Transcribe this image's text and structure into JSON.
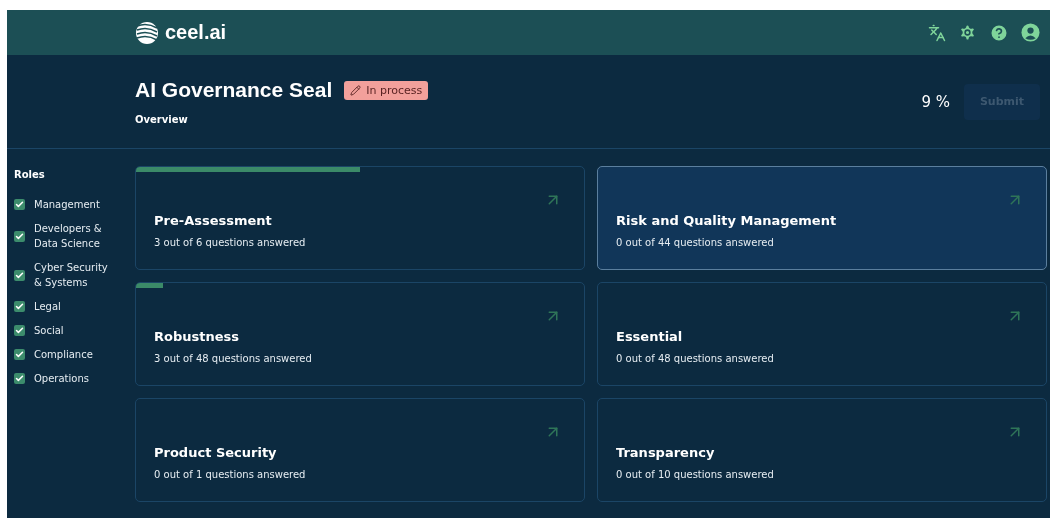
{
  "header": {
    "logo": "ceel.ai"
  },
  "page": {
    "title": "AI Governance Seal",
    "status": "In process",
    "subtitle": "Overview",
    "progress": "9 %",
    "submit": {
      "label": "Submit",
      "disabled": true
    }
  },
  "sidebar": {
    "heading": "Roles",
    "items": [
      {
        "label": "Management",
        "checked": true
      },
      {
        "label": "Developers & Data Science",
        "checked": true
      },
      {
        "label": "Cyber Security & Systems",
        "checked": true
      },
      {
        "label": "Legal",
        "checked": true
      },
      {
        "label": "Social",
        "checked": true
      },
      {
        "label": "Compliance",
        "checked": true
      },
      {
        "label": "Operations",
        "checked": true
      }
    ]
  },
  "cards": [
    {
      "title": "Pre-Assessment",
      "answered": "3 out of 6 questions answered",
      "level": 0.5,
      "selected": false
    },
    {
      "title": "Risk and Quality Management",
      "answered": "0 out of 44 questions answered",
      "selected": true
    },
    {
      "title": "Robustness",
      "answered": "3 out of 48 questions answered",
      "level": 0.06,
      "selected": false
    },
    {
      "title": "Essential",
      "answered": "0 out of 48 questions answered",
      "selected": false
    },
    {
      "title": "Product Security",
      "answered": "0 out of 1 questions answered",
      "selected": false
    },
    {
      "title": "Transparency",
      "answered": "0 out of 10 questions answered",
      "selected": false
    }
  ]
}
